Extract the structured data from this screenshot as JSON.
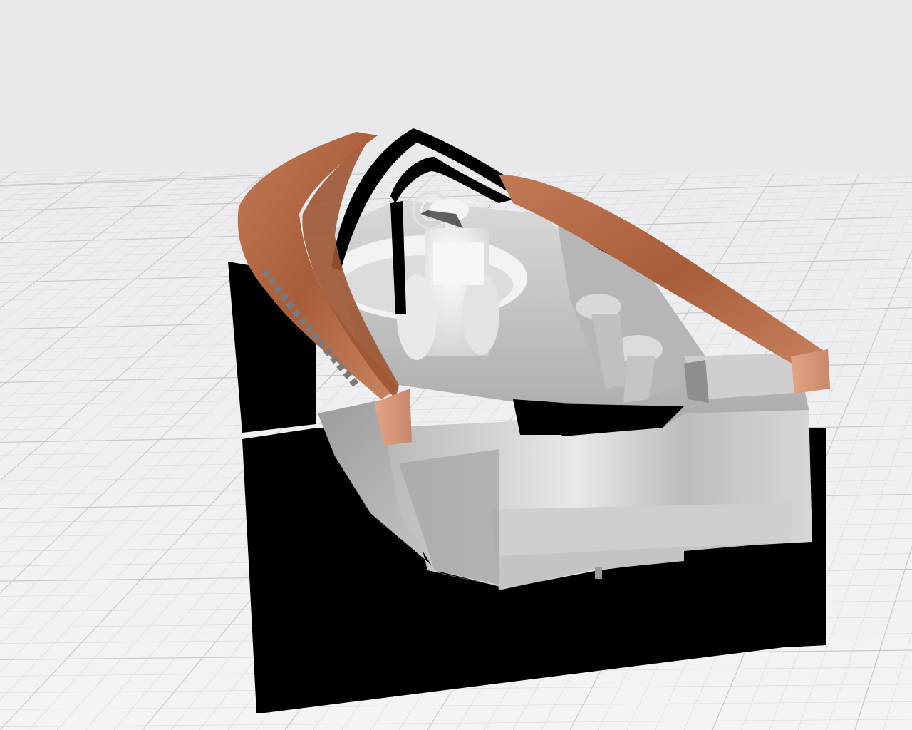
{
  "viewer": {
    "mode": "3d-model-preview",
    "background_color": "#e9e9eb",
    "grid_color": "#c9c9cc",
    "grid_fine_color": "#dcdcdf",
    "ui_text": []
  },
  "model": {
    "kind": "vehicle-cockpit",
    "colors": {
      "wood": "#b86a46",
      "wood_highlight": "#d99a78",
      "wood_shadow": "#8e4a2c",
      "metal": "#c7c7c7",
      "metal_light": "#efefef",
      "metal_dark": "#8d8d8d",
      "shadow": "#000000"
    }
  }
}
